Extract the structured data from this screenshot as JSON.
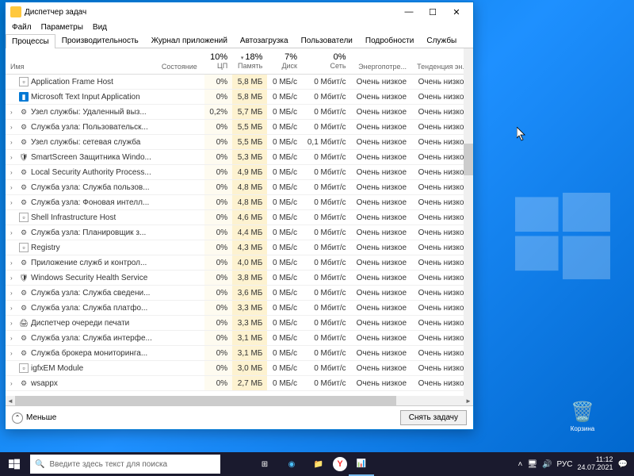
{
  "window": {
    "title": "Диспетчер задач",
    "menu": [
      "Файл",
      "Параметры",
      "Вид"
    ],
    "tabs": [
      "Процессы",
      "Производительность",
      "Журнал приложений",
      "Автозагрузка",
      "Пользователи",
      "Подробности",
      "Службы"
    ],
    "footer_less": "Меньше",
    "footer_end": "Снять задачу"
  },
  "columns": {
    "name": "Имя",
    "status": "Состояние",
    "cpu_pct": "10%",
    "cpu_lbl": "ЦП",
    "mem_pct": "18%",
    "mem_lbl": "Память",
    "disk_pct": "7%",
    "disk_lbl": "Диск",
    "net_pct": "0%",
    "net_lbl": "Сеть",
    "power_lbl": "Энергопотре...",
    "trend_lbl": "Тенденция эн..."
  },
  "rows": [
    {
      "exp": false,
      "icon": "app",
      "name": "Application Frame Host",
      "cpu": "0%",
      "mem": "5,8 МБ",
      "disk": "0 МБ/с",
      "net": "0 Мбит/с",
      "pwr": "Очень низкое",
      "trend": "Очень низкое"
    },
    {
      "exp": false,
      "icon": "msblue",
      "name": "Microsoft Text Input Application",
      "cpu": "0%",
      "mem": "5,8 МБ",
      "disk": "0 МБ/с",
      "net": "0 Мбит/с",
      "pwr": "Очень низкое",
      "trend": "Очень низкое"
    },
    {
      "exp": true,
      "icon": "gear",
      "name": "Узел службы: Удаленный выз...",
      "cpu": "0,2%",
      "mem": "5,7 МБ",
      "disk": "0 МБ/с",
      "net": "0 Мбит/с",
      "pwr": "Очень низкое",
      "trend": "Очень низкое"
    },
    {
      "exp": true,
      "icon": "gear",
      "name": "Служба узла: Пользовательск...",
      "cpu": "0%",
      "mem": "5,5 МБ",
      "disk": "0 МБ/с",
      "net": "0 Мбит/с",
      "pwr": "Очень низкое",
      "trend": "Очень низкое"
    },
    {
      "exp": true,
      "icon": "gear",
      "name": "Узел службы: сетевая служба",
      "cpu": "0%",
      "mem": "5,5 МБ",
      "disk": "0 МБ/с",
      "net": "0,1 Мбит/с",
      "pwr": "Очень низкое",
      "trend": "Очень низкое"
    },
    {
      "exp": true,
      "icon": "shield",
      "name": "SmartScreen Защитника Windo...",
      "cpu": "0%",
      "mem": "5,3 МБ",
      "disk": "0 МБ/с",
      "net": "0 Мбит/с",
      "pwr": "Очень низкое",
      "trend": "Очень низкое"
    },
    {
      "exp": true,
      "icon": "gear",
      "name": "Local Security Authority Process...",
      "cpu": "0%",
      "mem": "4,9 МБ",
      "disk": "0 МБ/с",
      "net": "0 Мбит/с",
      "pwr": "Очень низкое",
      "trend": "Очень низкое"
    },
    {
      "exp": true,
      "icon": "gear",
      "name": "Служба узла: Служба пользов...",
      "cpu": "0%",
      "mem": "4,8 МБ",
      "disk": "0 МБ/с",
      "net": "0 Мбит/с",
      "pwr": "Очень низкое",
      "trend": "Очень низкое"
    },
    {
      "exp": true,
      "icon": "gear",
      "name": "Служба узла: Фоновая интелл...",
      "cpu": "0%",
      "mem": "4,8 МБ",
      "disk": "0 МБ/с",
      "net": "0 Мбит/с",
      "pwr": "Очень низкое",
      "trend": "Очень низкое"
    },
    {
      "exp": false,
      "icon": "app",
      "name": "Shell Infrastructure Host",
      "cpu": "0%",
      "mem": "4,6 МБ",
      "disk": "0 МБ/с",
      "net": "0 Мбит/с",
      "pwr": "Очень низкое",
      "trend": "Очень низкое"
    },
    {
      "exp": true,
      "icon": "gear",
      "name": "Служба узла: Планировщик з...",
      "cpu": "0%",
      "mem": "4,4 МБ",
      "disk": "0 МБ/с",
      "net": "0 Мбит/с",
      "pwr": "Очень низкое",
      "trend": "Очень низкое"
    },
    {
      "exp": false,
      "icon": "app",
      "name": "Registry",
      "cpu": "0%",
      "mem": "4,3 МБ",
      "disk": "0 МБ/с",
      "net": "0 Мбит/с",
      "pwr": "Очень низкое",
      "trend": "Очень низкое"
    },
    {
      "exp": true,
      "icon": "gear",
      "name": "Приложение служб и контрол...",
      "cpu": "0%",
      "mem": "4,0 МБ",
      "disk": "0 МБ/с",
      "net": "0 Мбит/с",
      "pwr": "Очень низкое",
      "trend": "Очень низкое"
    },
    {
      "exp": true,
      "icon": "shield",
      "name": "Windows Security Health Service",
      "cpu": "0%",
      "mem": "3,8 МБ",
      "disk": "0 МБ/с",
      "net": "0 Мбит/с",
      "pwr": "Очень низкое",
      "trend": "Очень низкое"
    },
    {
      "exp": true,
      "icon": "gear",
      "name": "Служба узла: Служба сведени...",
      "cpu": "0%",
      "mem": "3,6 МБ",
      "disk": "0 МБ/с",
      "net": "0 Мбит/с",
      "pwr": "Очень низкое",
      "trend": "Очень низкое"
    },
    {
      "exp": true,
      "icon": "gear",
      "name": "Служба узла: Служба платфо...",
      "cpu": "0%",
      "mem": "3,3 МБ",
      "disk": "0 МБ/с",
      "net": "0 Мбит/с",
      "pwr": "Очень низкое",
      "trend": "Очень низкое"
    },
    {
      "exp": true,
      "icon": "print",
      "name": "Диспетчер очереди печати",
      "cpu": "0%",
      "mem": "3,3 МБ",
      "disk": "0 МБ/с",
      "net": "0 Мбит/с",
      "pwr": "Очень низкое",
      "trend": "Очень низкое"
    },
    {
      "exp": true,
      "icon": "gear",
      "name": "Служба узла: Служба интерфе...",
      "cpu": "0%",
      "mem": "3,1 МБ",
      "disk": "0 МБ/с",
      "net": "0 Мбит/с",
      "pwr": "Очень низкое",
      "trend": "Очень низкое"
    },
    {
      "exp": true,
      "icon": "gear",
      "name": "Служба брокера мониторинга...",
      "cpu": "0%",
      "mem": "3,1 МБ",
      "disk": "0 МБ/с",
      "net": "0 Мбит/с",
      "pwr": "Очень низкое",
      "trend": "Очень низкое"
    },
    {
      "exp": false,
      "icon": "app",
      "name": "igfxEM Module",
      "cpu": "0%",
      "mem": "3,0 МБ",
      "disk": "0 МБ/с",
      "net": "0 Мбит/с",
      "pwr": "Очень низкое",
      "trend": "Очень низкое"
    },
    {
      "exp": true,
      "icon": "gear",
      "name": "wsappx",
      "cpu": "0%",
      "mem": "2,7 МБ",
      "disk": "0 МБ/с",
      "net": "0 Мбит/с",
      "pwr": "Очень низкое",
      "trend": "Очень низкое"
    }
  ],
  "desktop": {
    "recycle": "Корзина"
  },
  "taskbar": {
    "search_placeholder": "Введите здесь текст для поиска",
    "lang": "РУС",
    "time": "11:12",
    "date": "24.07.2021"
  }
}
